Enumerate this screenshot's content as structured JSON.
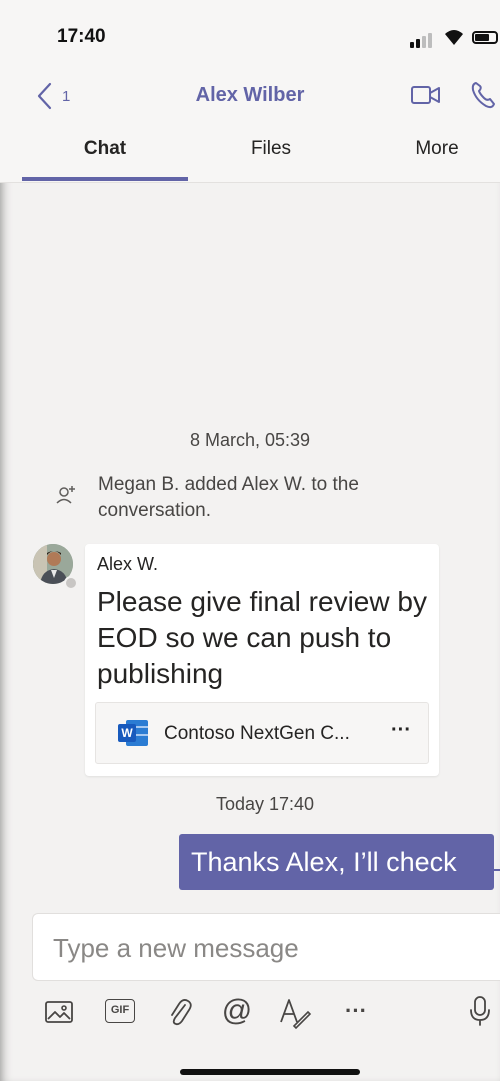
{
  "status": {
    "time": "17:40"
  },
  "header": {
    "back_count": "1",
    "title": "Alex Wilber"
  },
  "tabs": [
    {
      "label": "Chat"
    },
    {
      "label": "Files"
    },
    {
      "label": "More"
    }
  ],
  "chat": {
    "date_separator": "8 March, 05:39",
    "system_message": "Megan B. added Alex W. to the conversation.",
    "message": {
      "sender": "Alex W.",
      "text": "Please give final review by EOD so we can push to publishing",
      "attachment": {
        "name": "Contoso NextGen C...",
        "more": "···"
      }
    },
    "today_separator": "Today 17:40",
    "my_message": "Thanks Alex, I’ll check"
  },
  "compose": {
    "placeholder": "Type a new message"
  },
  "toolbar": {
    "gif_label": "GIF",
    "at_label": "@",
    "more_label": "···"
  },
  "colors": {
    "brand": "#6264a7",
    "background": "#f3f2f1",
    "word_blue": "#185abd"
  },
  "icons": [
    "back-chevron-icon",
    "video-call-icon",
    "phone-call-icon",
    "add-person-icon",
    "word-doc-icon",
    "image-icon",
    "gif-icon",
    "attach-icon",
    "mention-icon",
    "format-icon",
    "more-icon",
    "mic-icon"
  ]
}
